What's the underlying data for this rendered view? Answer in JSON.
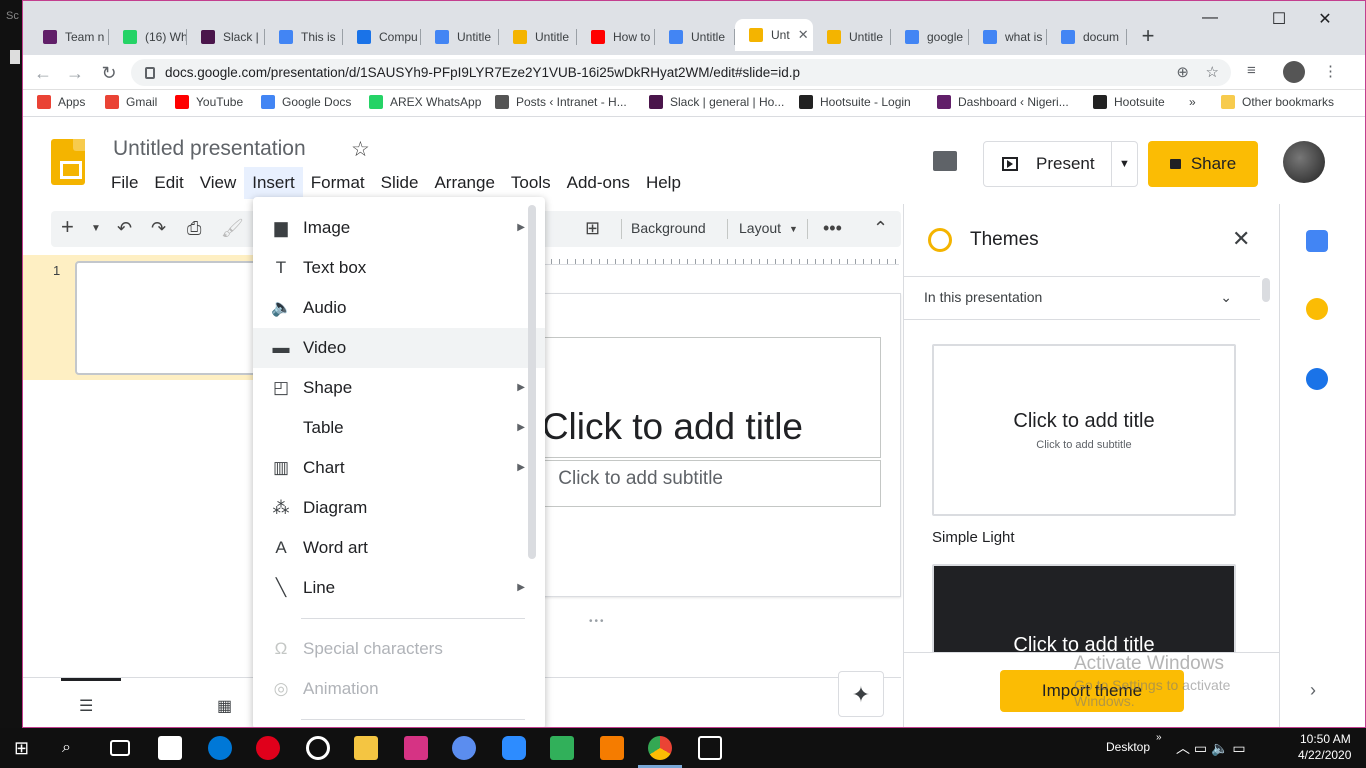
{
  "tabs": [
    {
      "label": "Team n",
      "color": "#611f69"
    },
    {
      "label": "(16) Wh",
      "color": "#25d366"
    },
    {
      "label": "Slack | ",
      "color": "#4a154b"
    },
    {
      "label": "This is",
      "color": "#4285f4"
    },
    {
      "label": "Compu",
      "color": "#1a73e8"
    },
    {
      "label": "Untitle",
      "color": "#4285f4"
    },
    {
      "label": "Untitle",
      "color": "#f4b400"
    },
    {
      "label": "How to",
      "color": "#ff0000"
    },
    {
      "label": "Untitle",
      "color": "#4285f4"
    },
    {
      "label": "Unt",
      "color": "#f4b400"
    },
    {
      "label": "Untitle",
      "color": "#f4b400"
    },
    {
      "label": "google",
      "color": "#4285f4"
    },
    {
      "label": "what is",
      "color": "#4285f4"
    },
    {
      "label": "docum",
      "color": "#4285f4"
    }
  ],
  "browser": {
    "url": "docs.google.com/presentation/d/1SAUSYh9-PFpI9LYR7Eze2Y1VUB-16i25wDkRHyat2WM/edit#slide=id.p"
  },
  "bookmarks": [
    {
      "label": "Apps",
      "color": "#ea4335"
    },
    {
      "label": "Gmail",
      "color": "#ea4335"
    },
    {
      "label": "YouTube",
      "color": "#ff0000"
    },
    {
      "label": "Google Docs",
      "color": "#4285f4"
    },
    {
      "label": "AREX WhatsApp",
      "color": "#25d366"
    },
    {
      "label": "Posts ‹ Intranet - H...",
      "color": "#555555"
    },
    {
      "label": "Slack | general | Ho...",
      "color": "#4a154b"
    },
    {
      "label": "Hootsuite - Login",
      "color": "#222222"
    },
    {
      "label": "Dashboard ‹ Nigeri...",
      "color": "#611f69"
    },
    {
      "label": "Hootsuite",
      "color": "#222222"
    },
    {
      "label": "»",
      "color": ""
    },
    {
      "label": "Other bookmarks",
      "color": "#f7cb4d"
    }
  ],
  "doc": {
    "title": "Untitled presentation"
  },
  "menubar": [
    "File",
    "Edit",
    "View",
    "Insert",
    "Format",
    "Slide",
    "Arrange",
    "Tools",
    "Add-ons",
    "Help"
  ],
  "header": {
    "present_label": "Present",
    "share_label": "Share"
  },
  "edit_toolbar": {
    "background_label": "Background",
    "layout_label": "Layout"
  },
  "filmstrip": {
    "slide_number": "1"
  },
  "slide": {
    "title_placeholder": "Click to add title",
    "subtitle_placeholder": "Click to add subtitle"
  },
  "insert_menu": {
    "items": [
      {
        "label": "Image",
        "submenu": true,
        "icon": "image-icon",
        "glyph": "▆"
      },
      {
        "label": "Text box",
        "submenu": false,
        "icon": "text-box-icon",
        "glyph": "T"
      },
      {
        "label": "Audio",
        "submenu": false,
        "icon": "audio-icon",
        "glyph": "🔈"
      },
      {
        "label": "Video",
        "submenu": false,
        "icon": "video-icon",
        "glyph": "▬"
      },
      {
        "label": "Shape",
        "submenu": true,
        "icon": "shape-icon",
        "glyph": "◰"
      },
      {
        "label": "Table",
        "submenu": true,
        "icon": "",
        "glyph": ""
      },
      {
        "label": "Chart",
        "submenu": true,
        "icon": "chart-icon",
        "glyph": "▥"
      },
      {
        "label": "Diagram",
        "submenu": false,
        "icon": "diagram-icon",
        "glyph": "⁂"
      },
      {
        "label": "Word art",
        "submenu": false,
        "icon": "word-art-icon",
        "glyph": "A"
      },
      {
        "label": "Line",
        "submenu": true,
        "icon": "line-icon",
        "glyph": "╲"
      }
    ],
    "disabled_items": [
      {
        "label": "Special characters",
        "icon": "omega-icon",
        "glyph": "Ω"
      },
      {
        "label": "Animation",
        "icon": "animation-icon",
        "glyph": "◎"
      }
    ],
    "highlighted": "Video"
  },
  "themes": {
    "title": "Themes",
    "filter_label": "In this presentation",
    "cards": [
      {
        "name": "Simple Light",
        "title": "Click to add title",
        "subtitle": "Click to add subtitle"
      },
      {
        "title": "Click to add title"
      }
    ],
    "import_label": "Import theme"
  },
  "watermark": {
    "line1": "Activate Windows",
    "line2": "Go to Settings to activate Windows."
  },
  "taskbar": {
    "desktop_label": "Desktop",
    "time": "10:50 AM",
    "date": "4/22/2020"
  }
}
